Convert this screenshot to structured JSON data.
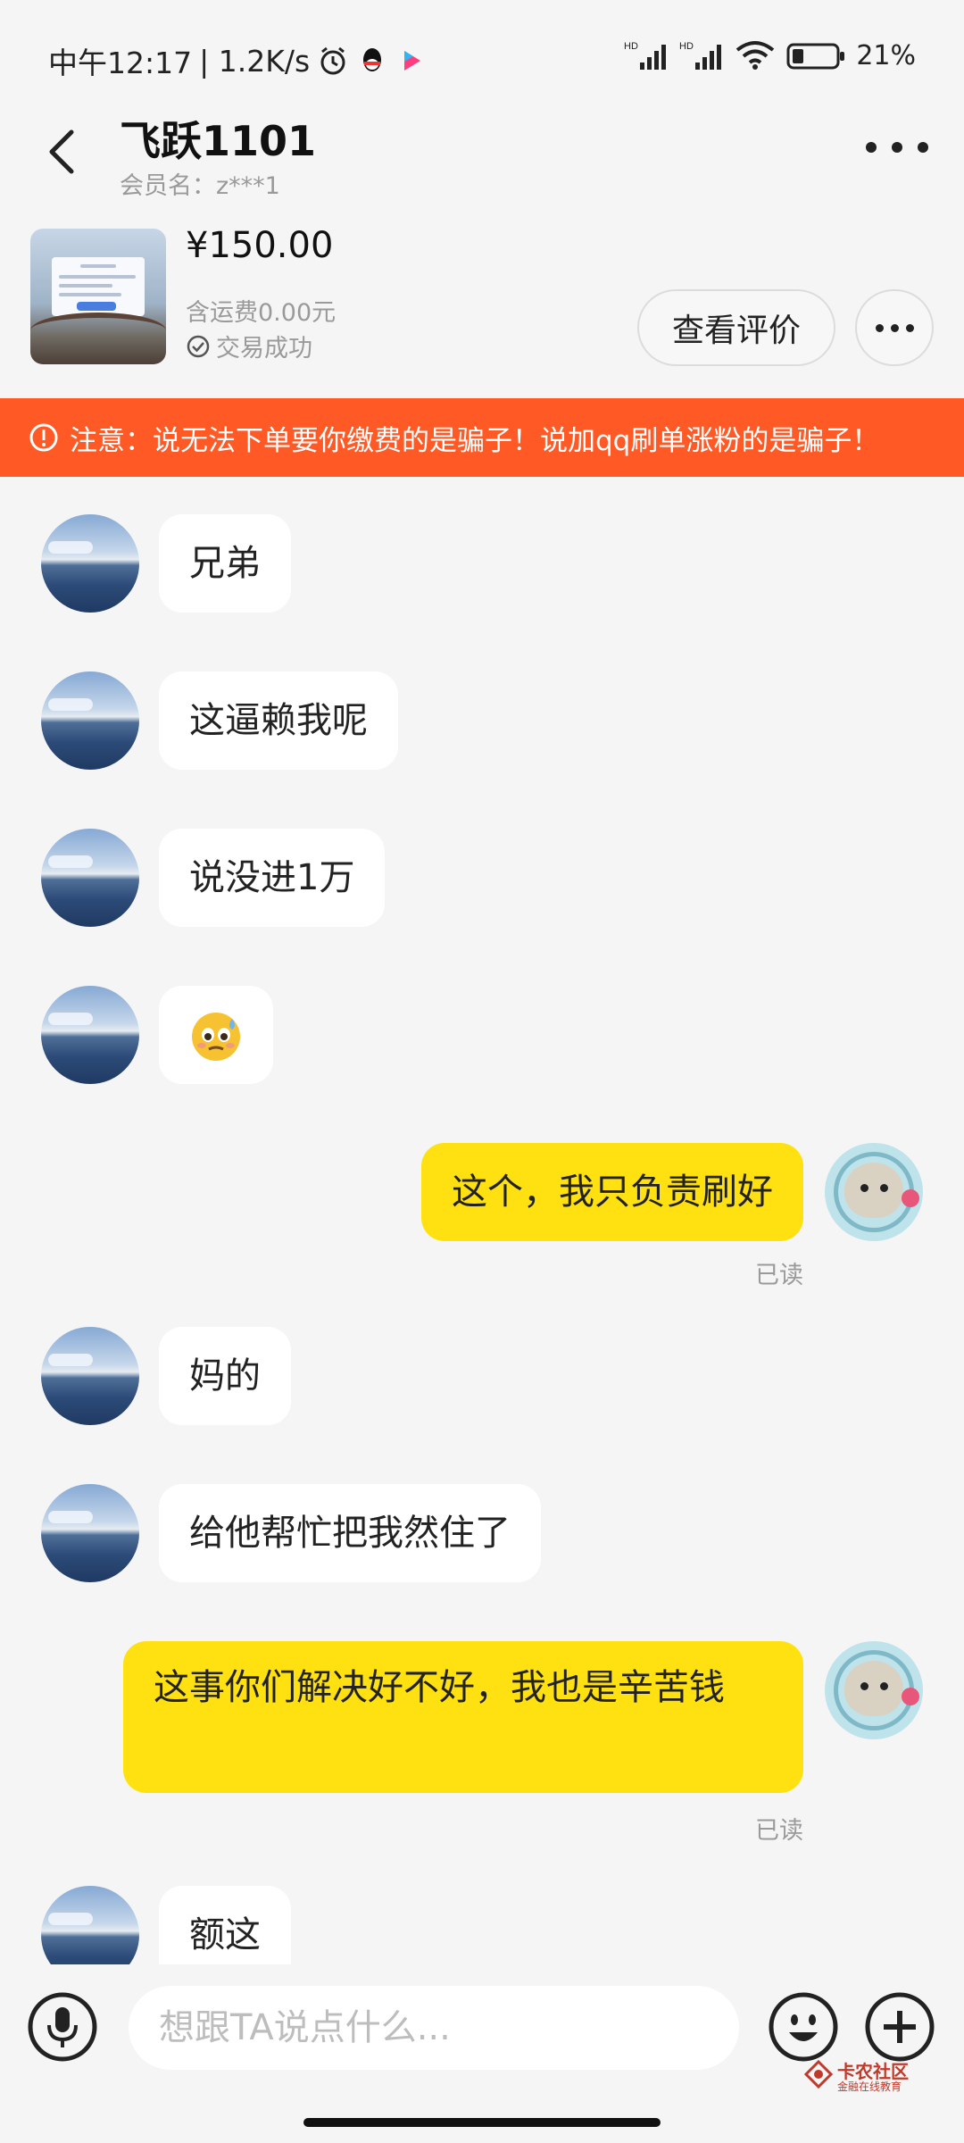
{
  "status_bar": {
    "time": "中午12:17",
    "network_speed": "| 1.2K/s",
    "battery": "21%"
  },
  "header": {
    "title": "飞跃1101",
    "subtitle": "会员名：z***1"
  },
  "product": {
    "price": "¥150.00",
    "shipping": "含运费0.00元",
    "status": "交易成功",
    "review_button": "查看评价"
  },
  "warning": {
    "text": "注意：说无法下单要你缴费的是骗子！说加qq刷单涨粉的是骗子！"
  },
  "messages": [
    {
      "side": "in",
      "text": "兄弟"
    },
    {
      "side": "in",
      "text": "这逼赖我呢"
    },
    {
      "side": "in",
      "text": "说没进1万"
    },
    {
      "side": "in",
      "text": "",
      "emoji": "anxious-sweat-face"
    },
    {
      "side": "out",
      "text": "这个，我只负责刷好",
      "read": "已读"
    },
    {
      "side": "in",
      "text": "妈的"
    },
    {
      "side": "in",
      "text": "给他帮忙把我然住了"
    },
    {
      "side": "out",
      "text": "这事你们解决好不好，我也是辛苦钱",
      "read": "已读"
    },
    {
      "side": "in",
      "text": "额这"
    }
  ],
  "input": {
    "placeholder": "想跟TA说点什么..."
  },
  "watermark": {
    "name": "卡农社区",
    "tagline": "金融在线教育"
  },
  "colors": {
    "warning_bg": "#ff5a26",
    "outgoing_bubble": "#ffe111",
    "incoming_bubble": "#ffffff",
    "background": "#f5f5f5"
  }
}
